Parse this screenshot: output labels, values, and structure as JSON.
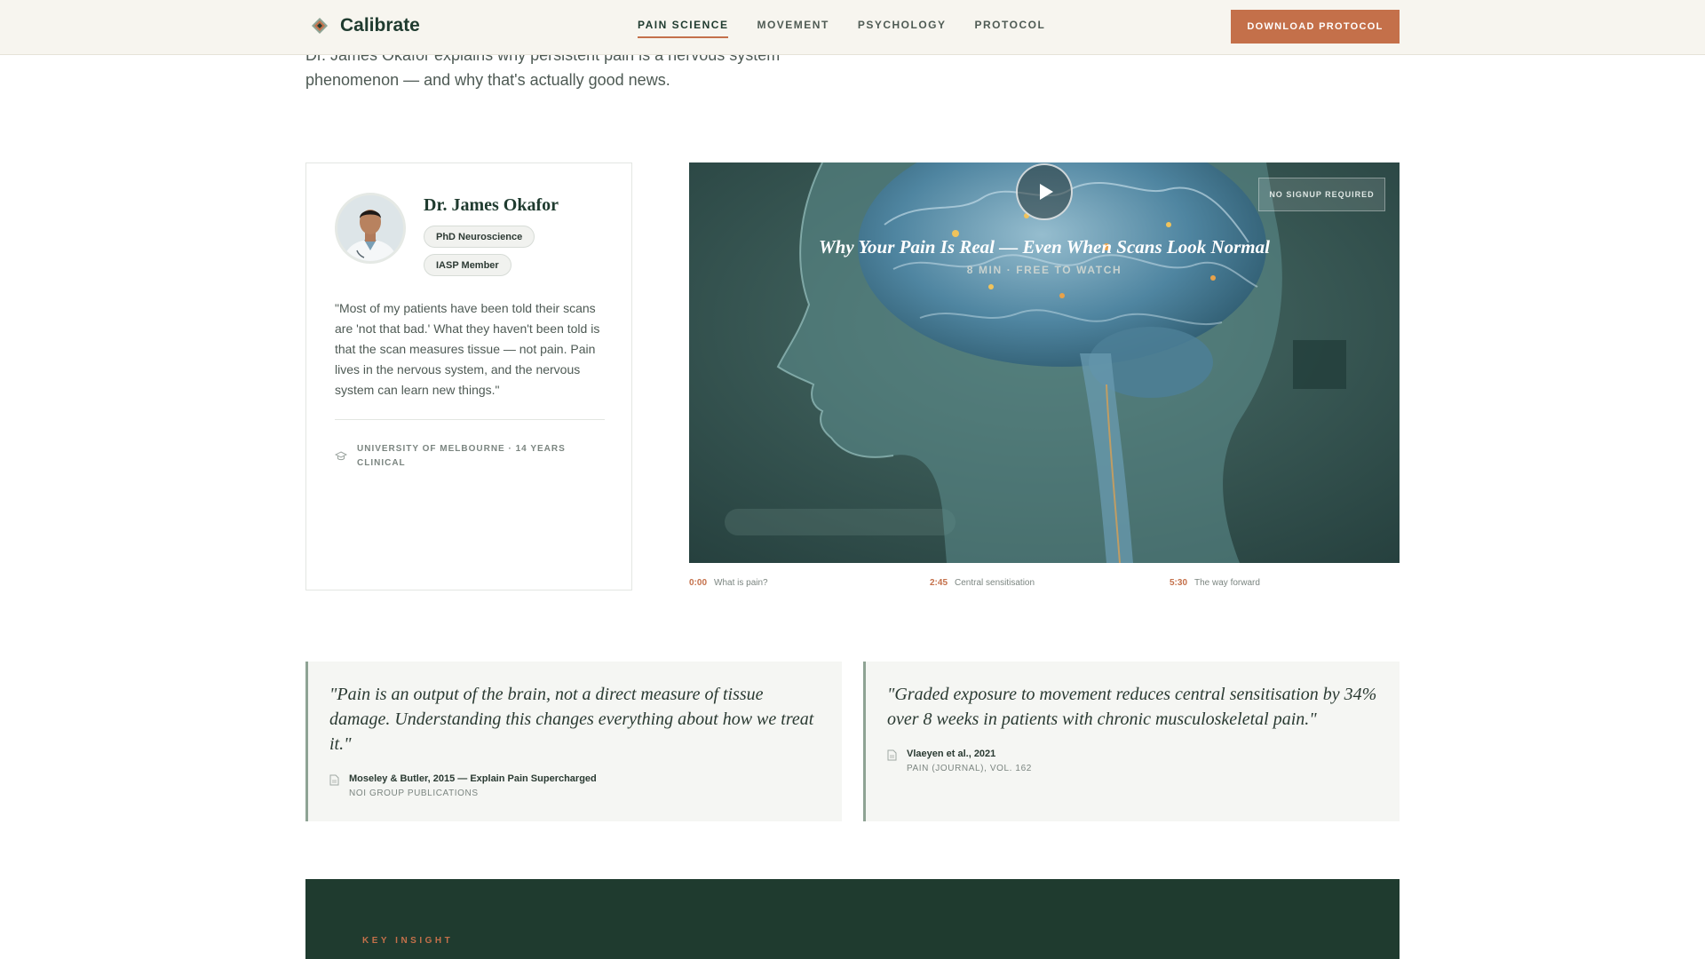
{
  "header": {
    "brand": "Calibrate",
    "nav": [
      {
        "label": "PAIN SCIENCE",
        "active": true
      },
      {
        "label": "MOVEMENT",
        "active": false
      },
      {
        "label": "PSYCHOLOGY",
        "active": false
      },
      {
        "label": "PROTOCOL",
        "active": false
      }
    ],
    "cta_label": "DOWNLOAD PROTOCOL"
  },
  "intro": {
    "text": "Dr. James Okafor explains why persistent pain is a nervous system phenomenon — and why that's actually good news."
  },
  "doctor": {
    "name": "Dr. James Okafor",
    "badges": [
      "PhD Neuroscience",
      "IASP Member"
    ],
    "quote": "\"Most of my patients have been told their scans are 'not that bad.' What they haven't been told is that the scan measures tissue — not pain. Pain lives in the nervous system, and the nervous system can learn new things.\"",
    "credential": "UNIVERSITY OF MELBOURNE · 14 YEARS CLINICAL"
  },
  "video": {
    "title": "Why Your Pain Is Real — Even When Scans Look Normal",
    "meta": "8 MIN · FREE TO WATCH",
    "tag": "NO SIGNUP REQUIRED",
    "chapters": [
      {
        "time": "0:00",
        "label": "What is pain?"
      },
      {
        "time": "2:45",
        "label": "Central sensitisation"
      },
      {
        "time": "5:30",
        "label": "The way forward"
      }
    ]
  },
  "citations": [
    {
      "quote": "\"Pain is an output of the brain, not a direct measure of tissue damage. Understanding this changes everything about how we treat it.\"",
      "source": "Moseley & Butler, 2015 — Explain Pain Supercharged",
      "publisher": "NOI GROUP PUBLICATIONS"
    },
    {
      "quote": "\"Graded exposure to movement reduces central sensitisation by 34% over 8 weeks in patients with chronic musculoskeletal pain.\"",
      "source": "Vlaeyen et al., 2021",
      "publisher": "PAIN (JOURNAL), VOL. 162"
    }
  ],
  "insight": {
    "label": "KEY INSIGHT"
  },
  "colors": {
    "brand_green": "#1f3b2f",
    "accent": "#c4704a",
    "header_bg": "#f7f5ef",
    "quote_bg": "#f5f6f3"
  },
  "icons": {
    "logo": "calibrate-logo-icon",
    "play": "play-icon",
    "credential": "graduation-cap-icon",
    "citation": "document-icon"
  }
}
